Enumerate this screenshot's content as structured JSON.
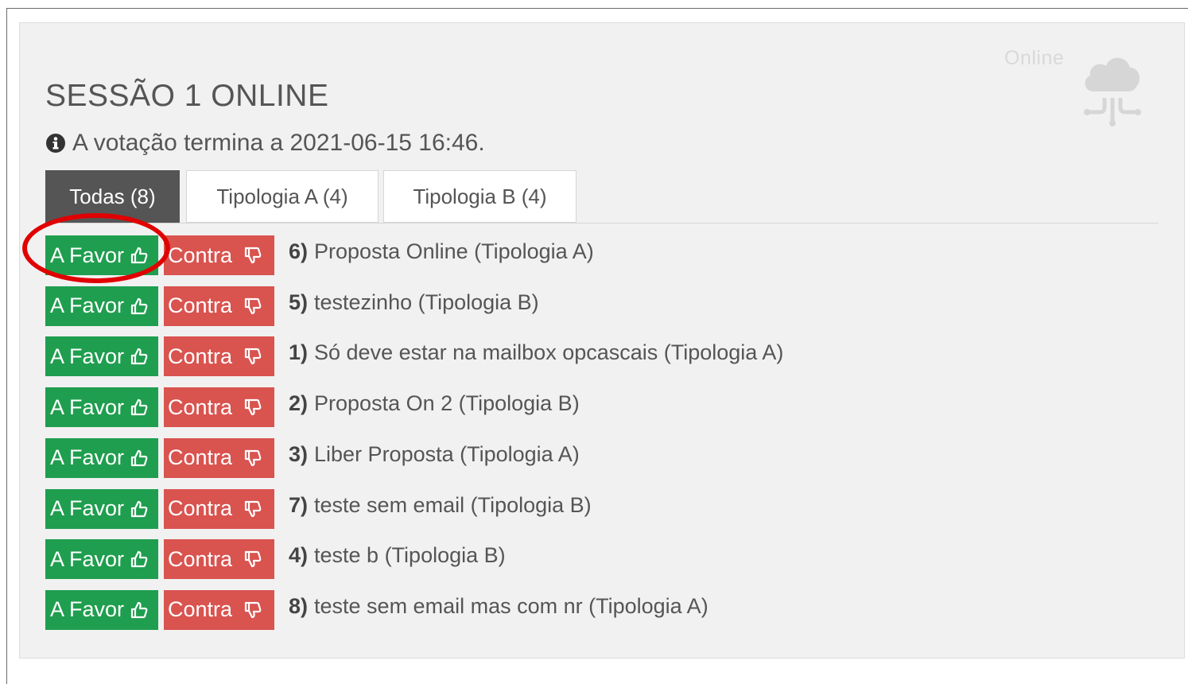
{
  "session": {
    "title": "SESSÃO 1 ONLINE",
    "deadline_text": "A votação termina a 2021-06-15 16:46.",
    "online_label": "Online"
  },
  "tabs": [
    {
      "label": "Todas (8)",
      "active": true
    },
    {
      "label": "Tipologia A (4)",
      "active": false
    },
    {
      "label": "Tipologia B (4)",
      "active": false
    }
  ],
  "buttons": {
    "favor_label": "A Favor",
    "contra_label": "Contra"
  },
  "proposals": [
    {
      "num": "6)",
      "text": "Proposta Online (Tipologia A)"
    },
    {
      "num": "5)",
      "text": "testezinho (Tipologia B)"
    },
    {
      "num": "1)",
      "text": "Só deve estar na mailbox opcascais (Tipologia A)"
    },
    {
      "num": "2)",
      "text": "Proposta On 2 (Tipologia B)"
    },
    {
      "num": "3)",
      "text": "Liber Proposta (Tipologia A)"
    },
    {
      "num": "7)",
      "text": "teste sem email (Tipologia B)"
    },
    {
      "num": "4)",
      "text": "teste b (Tipologia B)"
    },
    {
      "num": "8)",
      "text": "teste sem email mas com nr (Tipologia A)"
    }
  ],
  "icons": {
    "favor": "thumbs-up-icon",
    "contra": "thumbs-down-icon",
    "info": "info-circle-icon",
    "online": "cloud-network-icon"
  },
  "colors": {
    "favor": "#1f9e4f",
    "contra": "#d9534f",
    "active_tab": "#555555",
    "highlight": "#e00000"
  }
}
